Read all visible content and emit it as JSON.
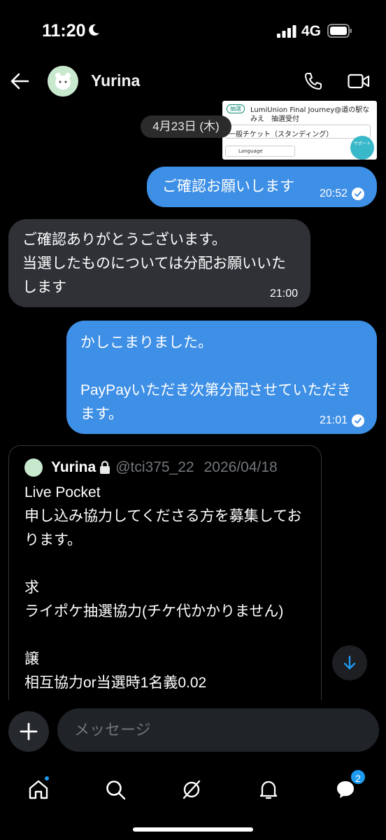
{
  "status_bar": {
    "time": "11:20",
    "network": "4G"
  },
  "header": {
    "name": "Yurina"
  },
  "thumbnail": {
    "badge": "抽選",
    "line1": "LumiUnion Final Journey@道の駅な",
    "line2": "みえ　抽選受付",
    "ticket": "一般チケット（スタンディング）",
    "language": "Language",
    "support": "サポート"
  },
  "date_pill": "4月23日 (木)",
  "messages": [
    {
      "dir": "out",
      "text": "ご確認お願いします",
      "time": "20:52",
      "read": true
    },
    {
      "dir": "in",
      "text": "ご確認ありがとうございます。\n当選したものについては分配お願いいたします",
      "time": "21:00"
    },
    {
      "dir": "out",
      "text": "かしこまりました。\n\nPayPayいただき次第分配させていただきます。",
      "time": "21:01",
      "read": true
    }
  ],
  "quoted_post": {
    "name": "Yurina",
    "handle": "@tci375_22",
    "date": "2026/04/18",
    "body": "Live Pocket\n申し込み協力してくださる方を募集しております。\n\n求\nライポケ抽選協力(チケ代かかりません)\n\n譲\n相互協力or当選時1名義0.02\n\n画像をご確認いただき、DMからお声が"
  },
  "composer": {
    "placeholder": "メッセージ"
  },
  "nav": {
    "messages_badge": "2"
  },
  "colors": {
    "accent": "#1d9bf0",
    "bubble_out": "#3e8fe6",
    "bubble_in": "#2f3136"
  }
}
